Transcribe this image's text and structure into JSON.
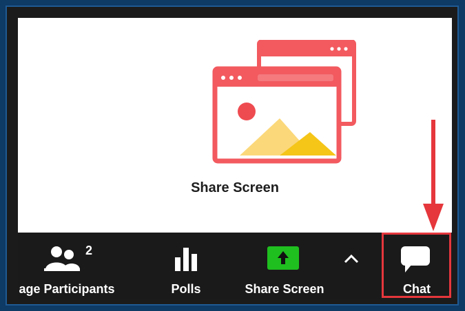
{
  "main": {
    "share_screen_caption": "Share Screen"
  },
  "toolbar": {
    "participants": {
      "label": "age Participants",
      "count": "2",
      "icon": "participants-icon"
    },
    "polls": {
      "label": "Polls",
      "icon": "bar-chart-icon"
    },
    "share_screen": {
      "label": "Share Screen",
      "icon": "share-screen-up-arrow-icon"
    },
    "more": {
      "icon": "chevron-up-icon"
    },
    "chat": {
      "label": "Chat",
      "icon": "chat-bubble-icon"
    }
  },
  "colors": {
    "toolbar_background": "#1a1a1a",
    "share_button_green": "#1fbf1f",
    "highlight_red": "#e5373c",
    "illustration_red": "#f25a5f",
    "illustration_yellow": "#f5c518"
  }
}
